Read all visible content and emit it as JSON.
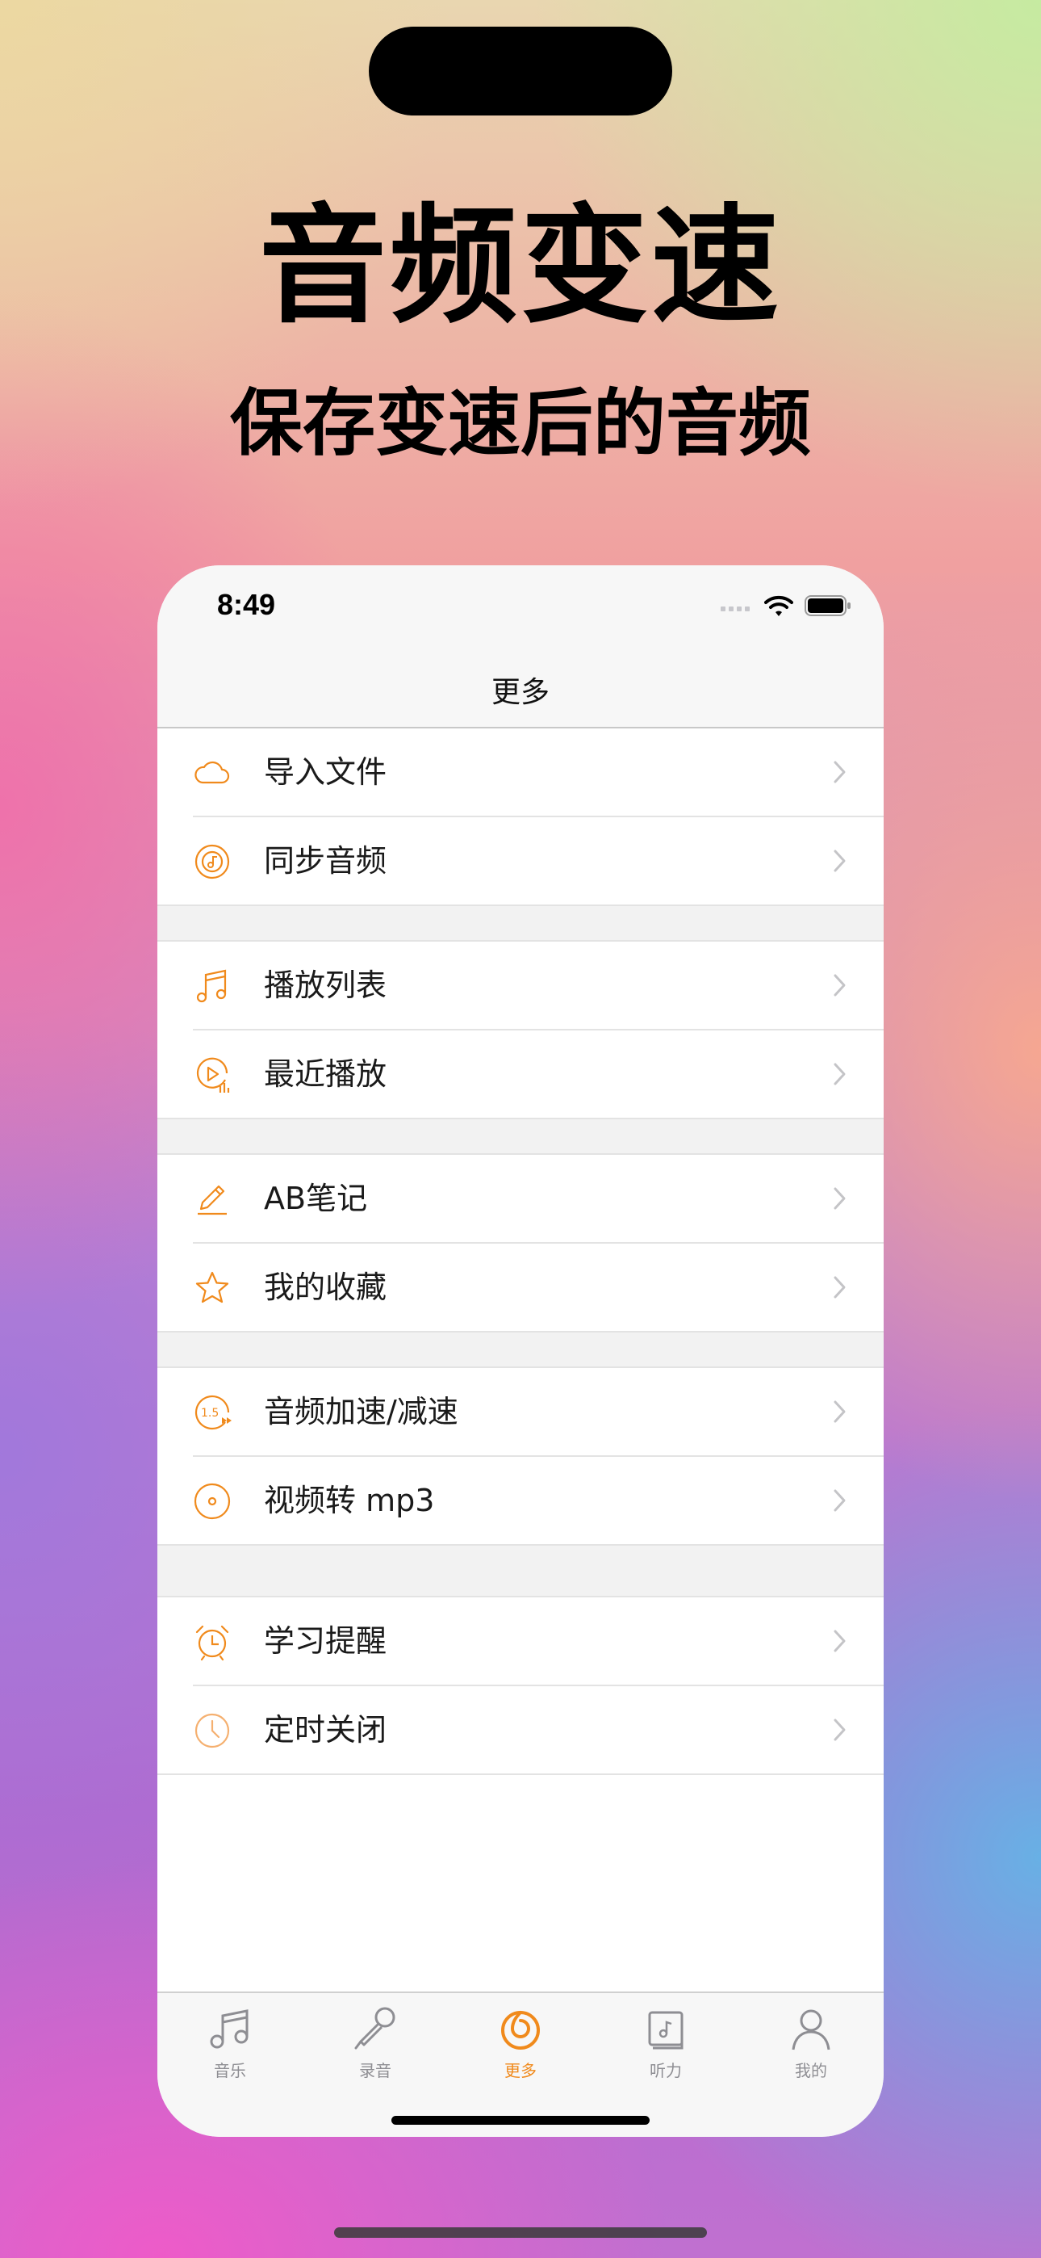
{
  "promo": {
    "title": "音频变速",
    "subtitle": "保存变速后的音频"
  },
  "status_bar": {
    "time": "8:49"
  },
  "nav": {
    "title": "更多"
  },
  "menu": {
    "import_file": "导入文件",
    "sync_audio": "同步音频",
    "playlist": "播放列表",
    "recent_play": "最近播放",
    "ab_notes": "AB笔记",
    "favorites": "我的收藏",
    "audio_speed": "音频加速/减速",
    "video_to_mp3": "视频转 mp3",
    "study_reminder": "学习提醒",
    "sleep_timer": "定时关闭"
  },
  "tabbar": {
    "music": "音乐",
    "record": "录音",
    "more": "更多",
    "listening": "听力",
    "mine": "我的"
  },
  "colors": {
    "accent": "#f08a1c",
    "tab_inactive": "#8e8e93",
    "chevron": "#c4c4c7"
  }
}
